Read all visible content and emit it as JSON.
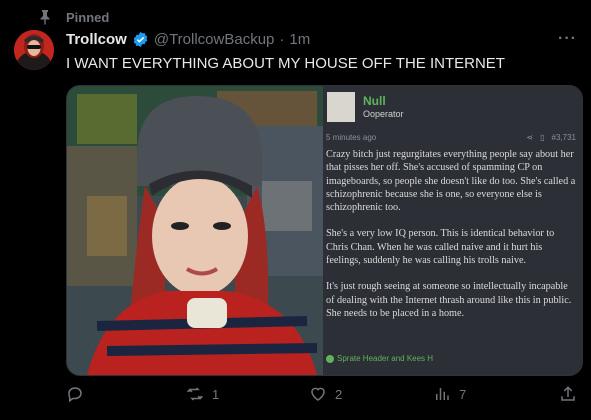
{
  "pinned": {
    "label": "Pinned"
  },
  "tweet": {
    "author_name": "Trollcow",
    "handle": "@TrollcowBackup",
    "separator": "·",
    "time": "1m",
    "text": "I WANT EVERYTHING ABOUT MY HOUSE OFF THE INTERNET",
    "verified_color": "#1d9bf0"
  },
  "screenshot_post": {
    "username": "Null",
    "role": "Ooperator",
    "timestamp": "5 minutes ago",
    "post_number": "#3,731",
    "paragraphs": [
      "Crazy bitch just regurgitates everything people say about her that pisses her off. She's accused of spamming CP on imageboards, so people she doesn't like do too. She's called a schizophrenic because she is one, so everyone else is schizophrenic too.",
      "She's a very low IQ person. This is identical behavior to Chris Chan. When he was called naive and it hurt his feelings, suddenly he was calling his trolls naive.",
      "It's just rough seeing at someone so intellectually incapable of dealing with the Internet thrash around like this in public. She needs to be placed in a home."
    ],
    "reactions": "Sprate Header and Kees H",
    "accent_color": "#5fb35a"
  },
  "actions": {
    "retweet_count": "1",
    "like_count": "2",
    "view_count": "7"
  }
}
